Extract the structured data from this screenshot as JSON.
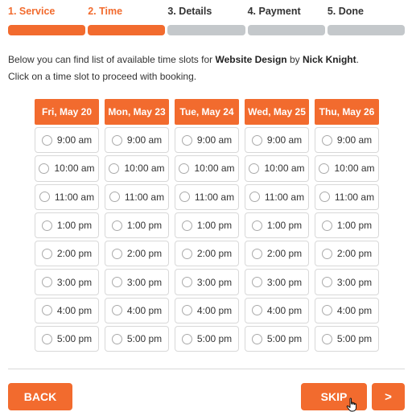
{
  "steps": [
    {
      "label": "1. Service",
      "state": "active"
    },
    {
      "label": "2. Time",
      "state": "active"
    },
    {
      "label": "3. Details",
      "state": "inactive"
    },
    {
      "label": "4. Payment",
      "state": "inactive"
    },
    {
      "label": "5. Done",
      "state": "inactive"
    }
  ],
  "intro": {
    "line1_prefix": "Below you can find list of available time slots for ",
    "service": "Website Design",
    "line1_mid": " by ",
    "staff": "Nick Knight",
    "line1_suffix": ".",
    "line2": "Click on a time slot to proceed with booking."
  },
  "days": [
    {
      "header": "Fri, May 20",
      "slots": [
        "9:00 am",
        "10:00 am",
        "11:00 am",
        "1:00 pm",
        "2:00 pm",
        "3:00 pm",
        "4:00 pm",
        "5:00 pm"
      ]
    },
    {
      "header": "Mon, May 23",
      "slots": [
        "9:00 am",
        "10:00 am",
        "11:00 am",
        "1:00 pm",
        "2:00 pm",
        "3:00 pm",
        "4:00 pm",
        "5:00 pm"
      ]
    },
    {
      "header": "Tue, May 24",
      "slots": [
        "9:00 am",
        "10:00 am",
        "11:00 am",
        "1:00 pm",
        "2:00 pm",
        "3:00 pm",
        "4:00 pm",
        "5:00 pm"
      ]
    },
    {
      "header": "Wed, May 25",
      "slots": [
        "9:00 am",
        "10:00 am",
        "11:00 am",
        "1:00 pm",
        "2:00 pm",
        "3:00 pm",
        "4:00 pm",
        "5:00 pm"
      ]
    },
    {
      "header": "Thu, May 26",
      "slots": [
        "9:00 am",
        "10:00 am",
        "11:00 am",
        "1:00 pm",
        "2:00 pm",
        "3:00 pm",
        "4:00 pm",
        "5:00 pm"
      ]
    }
  ],
  "buttons": {
    "back": "BACK",
    "skip": "SKIP",
    "next": ">"
  },
  "colors": {
    "accent": "#f26b2e",
    "inactive_bar": "#c4c8cb"
  },
  "icons": {
    "slot_radio": "radio-circle-icon",
    "cursor": "hand-pointer-icon"
  }
}
